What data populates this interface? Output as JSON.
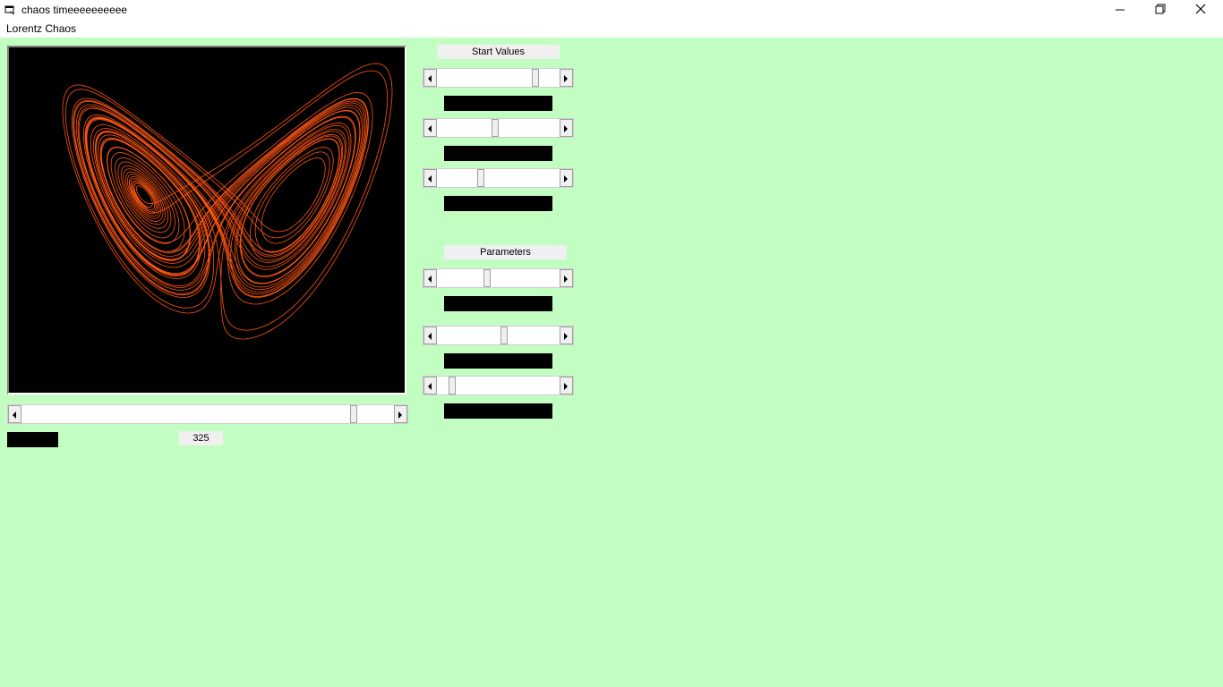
{
  "window": {
    "title": "chaos timeeeeeeeeee",
    "icon": "app-window-icon",
    "controls": [
      "minimize-icon",
      "restore-icon",
      "close-icon"
    ]
  },
  "menu": {
    "items": [
      "Lorentz Chaos"
    ]
  },
  "plot": {
    "background": "#000000",
    "trace_color": "#ff5511",
    "trace": "lorentz attractor",
    "time_scroll": {
      "value_fraction": 0.9
    },
    "status_value": "325"
  },
  "start_values": {
    "label": "Start Values",
    "sliders": [
      {
        "value_fraction": 0.82
      },
      {
        "value_fraction": 0.47
      },
      {
        "value_fraction": 0.35
      }
    ]
  },
  "parameters": {
    "label": "Parameters",
    "sliders": [
      {
        "value_fraction": 0.4
      },
      {
        "value_fraction": 0.55
      },
      {
        "value_fraction": 0.1
      }
    ]
  },
  "colors": {
    "background": "#c2fec2",
    "label_fill": "#000000",
    "panel": "#f0f0f0"
  }
}
